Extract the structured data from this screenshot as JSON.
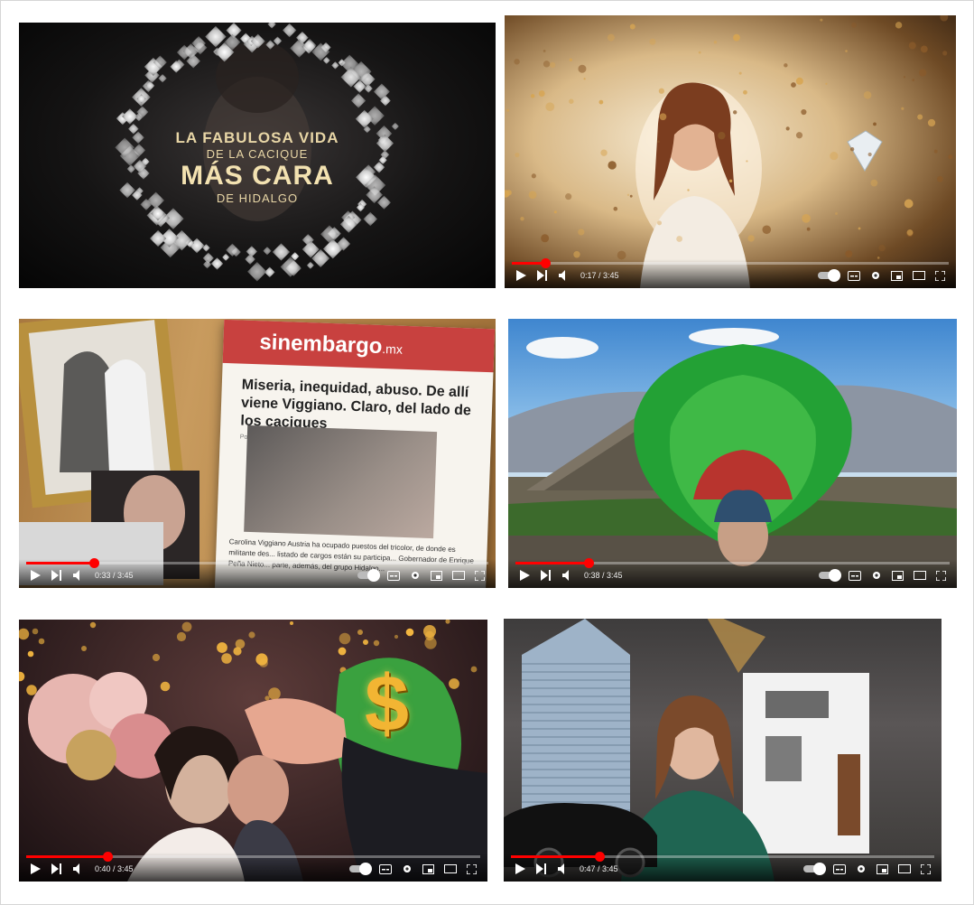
{
  "videos": [
    {
      "id": "v1",
      "title_lines": [
        "LA FABULOSA VIDA",
        "DE LA CACIQUE",
        "MÁS CARA",
        "DE HIDALGO"
      ],
      "has_controls": false
    },
    {
      "id": "v2",
      "time": "0:17 / 3:45",
      "progress": 0.076,
      "has_controls": true
    },
    {
      "id": "v3",
      "time": "0:33 / 3:45",
      "progress": 0.147,
      "has_controls": true,
      "newspaper": {
        "brand": "sinembargo",
        "brand_suffix": ".mx",
        "headline": "Miseria, inequidad, abuso. De allí viene Viggiano. Claro, del lado de los caciques",
        "byline": "Por Daniela Barragán",
        "body": "Carolina Viggiano Austria ha ocupado puestos del tricolor, de donde es militante des... listado de cargos están su participa... Gobernador de Enrique Peña Nieto... parte, además, del grupo Hidalgo..."
      }
    },
    {
      "id": "v4",
      "time": "0:38 / 3:45",
      "progress": 0.169,
      "has_controls": true
    },
    {
      "id": "v5",
      "time": "0:40 / 3:45",
      "progress": 0.178,
      "has_controls": true,
      "symbol": "$"
    },
    {
      "id": "v6",
      "time": "0:47 / 3:45",
      "progress": 0.209,
      "has_controls": true
    }
  ],
  "icons": {
    "play": "play-icon",
    "next": "next-icon",
    "volume": "volume-icon",
    "autoplay": "autoplay-toggle",
    "subtitles": "subtitles-icon",
    "settings": "settings-gear-icon",
    "miniplayer": "miniplayer-icon",
    "theater": "theater-icon",
    "fullscreen": "fullscreen-icon"
  },
  "colors": {
    "progress": "#ff0000",
    "title_gold": "#e8d6a6"
  }
}
